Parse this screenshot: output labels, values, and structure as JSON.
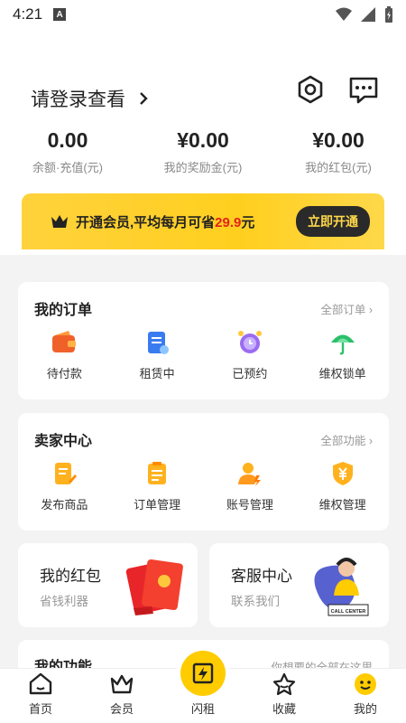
{
  "status": {
    "time": "4:21",
    "notification_glyph": "A"
  },
  "header": {
    "login_text": "请登录查看",
    "settings_icon": "settings-hexagon-icon",
    "message_icon": "message-dots-icon"
  },
  "balances": [
    {
      "value": "0.00",
      "label": "余额·充值(元)"
    },
    {
      "value": "¥0.00",
      "label": "我的奖励金(元)"
    },
    {
      "value": "¥0.00",
      "label": "我的红包(元)"
    }
  ],
  "vip": {
    "text_prefix": "开通会员,平均每月可省",
    "amount": "29.9",
    "text_suffix": "元",
    "button": "立即开通"
  },
  "orders": {
    "title": "我的订单",
    "link": "全部订单",
    "items": [
      {
        "label": "待付款",
        "icon": "wallet-icon"
      },
      {
        "label": "租赁中",
        "icon": "clipboard-icon"
      },
      {
        "label": "已预约",
        "icon": "alarm-clock-icon"
      },
      {
        "label": "维权锁单",
        "icon": "umbrella-icon"
      }
    ]
  },
  "seller": {
    "title": "卖家中心",
    "link": "全部功能",
    "items": [
      {
        "label": "发布商品",
        "icon": "document-edit-icon"
      },
      {
        "label": "订单管理",
        "icon": "order-list-icon"
      },
      {
        "label": "账号管理",
        "icon": "account-user-icon"
      },
      {
        "label": "维权管理",
        "icon": "shield-yen-icon"
      }
    ]
  },
  "red_packet": {
    "title": "我的红包",
    "subtitle": "省钱利器"
  },
  "service": {
    "title": "客服中心",
    "subtitle": "联系我们",
    "illustration_text": "CALL CENTER"
  },
  "functions": {
    "title": "我的功能",
    "hint": "你想要的全部在这里"
  },
  "nav": [
    {
      "label": "首页",
      "icon": "home-icon"
    },
    {
      "label": "会员",
      "icon": "crown-icon"
    },
    {
      "label": "闪租",
      "icon": "flash-icon"
    },
    {
      "label": "收藏",
      "icon": "star-icon"
    },
    {
      "label": "我的",
      "icon": "profile-face-icon"
    }
  ],
  "colors": {
    "accent": "#ffcc00",
    "highlight": "#e2231a",
    "dark": "#2a2a2a"
  }
}
